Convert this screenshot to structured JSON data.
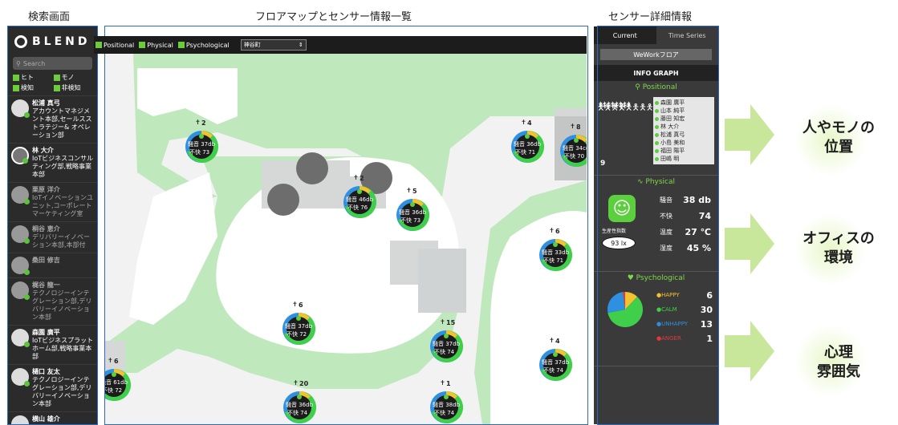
{
  "section_labels": {
    "search": "検索画面",
    "floormap": "フロアマップとセンサー情報一覧",
    "detail": "センサー詳細情報"
  },
  "left_panel": {
    "logo": "BLEND",
    "search_placeholder": "Search",
    "filters": [
      "ヒト",
      "モノ",
      "検知",
      "非検知"
    ],
    "people": [
      {
        "name": "松浦 真弓",
        "dept": "アカウントマネジメント本部,セールスストラテジー& オペレーション部",
        "active": true
      },
      {
        "name": "林 大介",
        "dept": "IoTビジネスコンサルティング部,戦略事業本部",
        "active": true
      },
      {
        "name": "栗原 洋介",
        "dept": "IoTイノベーションユニット,コーポレートマーケティング室",
        "active": false
      },
      {
        "name": "桐谷 恵介",
        "dept": "デリバリーイノベーション本部,本部付",
        "active": false
      },
      {
        "name": "桑田 修吉",
        "dept": "",
        "active": false
      },
      {
        "name": "梶谷 龍一",
        "dept": "テクノロジーインテグレーション部,デリバリーイノベーション本部",
        "active": false
      },
      {
        "name": "森園 廣平",
        "dept": "IoTビジネスプラットホーム部,戦略事業本部",
        "active": true
      },
      {
        "name": "樋口 友太",
        "dept": "テクノロジーインテグレーション部,デリバリーイノベーション本部",
        "active": true
      },
      {
        "name": "横山 雄介",
        "dept": "",
        "active": true
      }
    ]
  },
  "topbar": {
    "filters": [
      "Positional",
      "Physical",
      "Psychological"
    ],
    "location_select": "神谷町"
  },
  "sensors": [
    {
      "count": "2",
      "noise": "騒音 37db",
      "discomfort": "不快 73"
    },
    {
      "count": "2",
      "noise": "騒音 46db",
      "discomfort": "不快 76"
    },
    {
      "count": "5",
      "noise": "騒音 36db",
      "discomfort": "不快 73"
    },
    {
      "count": "4",
      "noise": "騒音 36db",
      "discomfort": "不快 71"
    },
    {
      "count": "8",
      "noise": "騒音 34cc",
      "discomfort": "不快 70"
    },
    {
      "count": "6",
      "noise": "騒音 33db",
      "discomfort": "不快 71"
    },
    {
      "count": "6",
      "noise": "騒音 37db",
      "discomfort": "不快 72"
    },
    {
      "count": "15",
      "noise": "騒音 37db",
      "discomfort": "不快 74"
    },
    {
      "count": "4",
      "noise": "騒音 37db",
      "discomfort": "不快 74"
    },
    {
      "count": "6",
      "noise": "騒音 61db",
      "discomfort": "不快 72"
    },
    {
      "count": "20",
      "noise": "騒音 36db",
      "discomfort": "不快 74"
    },
    {
      "count": "1",
      "noise": "騒音 38db",
      "discomfort": "不快 74"
    }
  ],
  "right_panel": {
    "tabs": [
      "Current",
      "Time Series"
    ],
    "floor_button": "WeWorkフロア",
    "info_graph": "INFO GRAPH",
    "positional": {
      "title": "Positional",
      "count": "9",
      "names": [
        "森園 廣平",
        "山本 純平",
        "藤田 知宏",
        "林 大介",
        "松浦 真弓",
        "小島 美和",
        "福田 陽平",
        "田嶋 明"
      ]
    },
    "physical": {
      "title": "Physical",
      "productivity_label": "生産性指数",
      "lux": "93 lx",
      "noise_label": "騒音",
      "noise_value": "38 db",
      "discomfort_label": "不快",
      "discomfort_value": "74",
      "temp_label": "温度",
      "temp_value": "27 ℃",
      "humidity_label": "湿度",
      "humidity_value": "45 %"
    },
    "psychological": {
      "title": "Psychological",
      "moods": [
        {
          "label": "HAPPY",
          "value": "6",
          "color": "#f2c230"
        },
        {
          "label": "CALM",
          "value": "30",
          "color": "#3fcf4b"
        },
        {
          "label": "UNHAPPY",
          "value": "13",
          "color": "#2f8fe0"
        },
        {
          "label": "ANGER",
          "value": "1",
          "color": "#e03a3a"
        }
      ]
    }
  },
  "side_labels": {
    "position": [
      "人やモノの",
      "位置"
    ],
    "environment": [
      "オフィスの",
      "環境"
    ],
    "mood": [
      "心理",
      "雰囲気"
    ]
  }
}
